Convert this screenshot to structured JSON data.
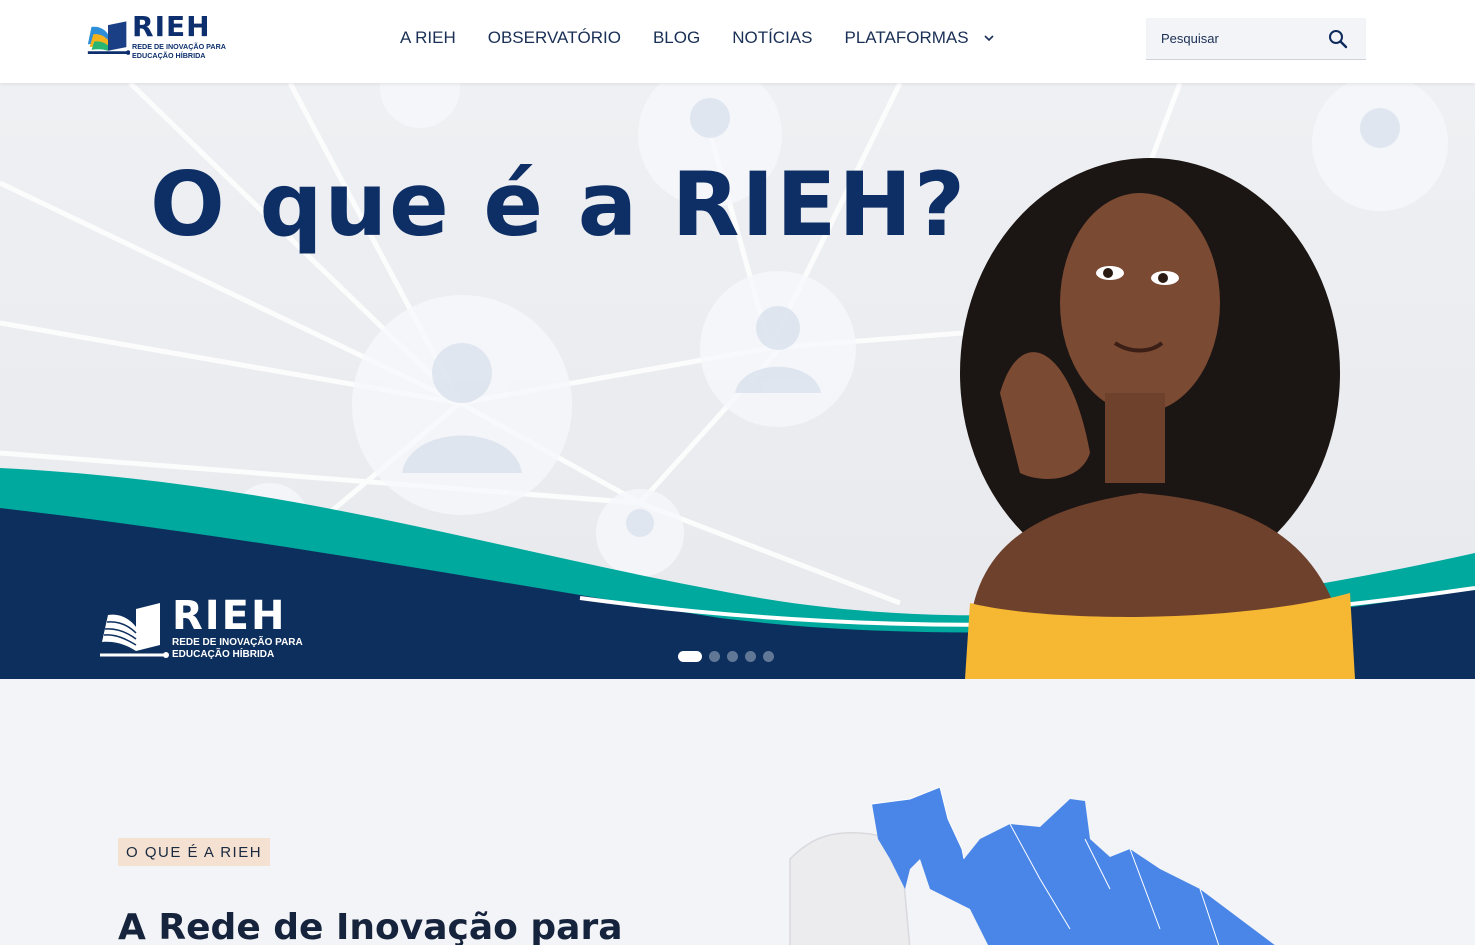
{
  "header": {
    "logo": {
      "title": "RIEH",
      "subtitle_line1": "REDE DE INOVAÇÃO PARA",
      "subtitle_line2": "EDUCAÇÃO HÍBRIDA"
    },
    "nav": [
      {
        "label": "A RIEH"
      },
      {
        "label": "OBSERVATÓRIO"
      },
      {
        "label": "BLOG"
      },
      {
        "label": "NOTÍCIAS"
      },
      {
        "label": "PLATAFORMAS",
        "has_dropdown": true
      }
    ],
    "search": {
      "placeholder": "Pesquisar",
      "value": ""
    }
  },
  "hero": {
    "title": "O que é a RIEH?",
    "logo": {
      "title": "RIEH",
      "subtitle_line1": "REDE DE INOVAÇÃO PARA",
      "subtitle_line2": "EDUCAÇÃO HÍBRIDA"
    },
    "slides": {
      "count": 5,
      "active": 1
    }
  },
  "about": {
    "badge": "O QUE É A RIEH",
    "heading_prefix": "A ",
    "heading_bold": "Rede de Inovação para"
  },
  "colors": {
    "navy": "#0e2f66",
    "teal": "#00a99d",
    "map_blue": "#4a86e8",
    "shirt_yellow": "#f6b733",
    "badge_bg": "#f5e1d2"
  },
  "icons": [
    "logo-book-icon",
    "chevron-down-icon",
    "search-icon"
  ]
}
